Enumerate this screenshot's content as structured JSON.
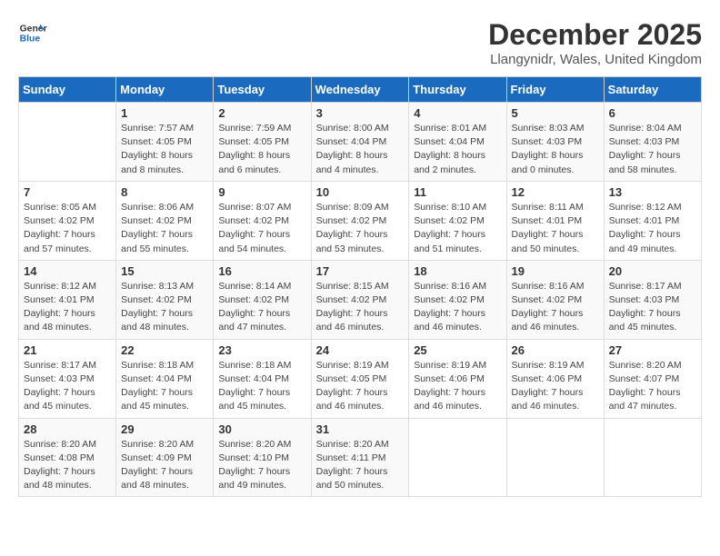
{
  "header": {
    "logo_line1": "General",
    "logo_line2": "Blue",
    "month_year": "December 2025",
    "location": "Llangynidr, Wales, United Kingdom"
  },
  "weekdays": [
    "Sunday",
    "Monday",
    "Tuesday",
    "Wednesday",
    "Thursday",
    "Friday",
    "Saturday"
  ],
  "weeks": [
    [
      {
        "day": "",
        "info": ""
      },
      {
        "day": "1",
        "info": "Sunrise: 7:57 AM\nSunset: 4:05 PM\nDaylight: 8 hours\nand 8 minutes."
      },
      {
        "day": "2",
        "info": "Sunrise: 7:59 AM\nSunset: 4:05 PM\nDaylight: 8 hours\nand 6 minutes."
      },
      {
        "day": "3",
        "info": "Sunrise: 8:00 AM\nSunset: 4:04 PM\nDaylight: 8 hours\nand 4 minutes."
      },
      {
        "day": "4",
        "info": "Sunrise: 8:01 AM\nSunset: 4:04 PM\nDaylight: 8 hours\nand 2 minutes."
      },
      {
        "day": "5",
        "info": "Sunrise: 8:03 AM\nSunset: 4:03 PM\nDaylight: 8 hours\nand 0 minutes."
      },
      {
        "day": "6",
        "info": "Sunrise: 8:04 AM\nSunset: 4:03 PM\nDaylight: 7 hours\nand 58 minutes."
      }
    ],
    [
      {
        "day": "7",
        "info": "Sunrise: 8:05 AM\nSunset: 4:02 PM\nDaylight: 7 hours\nand 57 minutes."
      },
      {
        "day": "8",
        "info": "Sunrise: 8:06 AM\nSunset: 4:02 PM\nDaylight: 7 hours\nand 55 minutes."
      },
      {
        "day": "9",
        "info": "Sunrise: 8:07 AM\nSunset: 4:02 PM\nDaylight: 7 hours\nand 54 minutes."
      },
      {
        "day": "10",
        "info": "Sunrise: 8:09 AM\nSunset: 4:02 PM\nDaylight: 7 hours\nand 53 minutes."
      },
      {
        "day": "11",
        "info": "Sunrise: 8:10 AM\nSunset: 4:02 PM\nDaylight: 7 hours\nand 51 minutes."
      },
      {
        "day": "12",
        "info": "Sunrise: 8:11 AM\nSunset: 4:01 PM\nDaylight: 7 hours\nand 50 minutes."
      },
      {
        "day": "13",
        "info": "Sunrise: 8:12 AM\nSunset: 4:01 PM\nDaylight: 7 hours\nand 49 minutes."
      }
    ],
    [
      {
        "day": "14",
        "info": "Sunrise: 8:12 AM\nSunset: 4:01 PM\nDaylight: 7 hours\nand 48 minutes."
      },
      {
        "day": "15",
        "info": "Sunrise: 8:13 AM\nSunset: 4:02 PM\nDaylight: 7 hours\nand 48 minutes."
      },
      {
        "day": "16",
        "info": "Sunrise: 8:14 AM\nSunset: 4:02 PM\nDaylight: 7 hours\nand 47 minutes."
      },
      {
        "day": "17",
        "info": "Sunrise: 8:15 AM\nSunset: 4:02 PM\nDaylight: 7 hours\nand 46 minutes."
      },
      {
        "day": "18",
        "info": "Sunrise: 8:16 AM\nSunset: 4:02 PM\nDaylight: 7 hours\nand 46 minutes."
      },
      {
        "day": "19",
        "info": "Sunrise: 8:16 AM\nSunset: 4:02 PM\nDaylight: 7 hours\nand 46 minutes."
      },
      {
        "day": "20",
        "info": "Sunrise: 8:17 AM\nSunset: 4:03 PM\nDaylight: 7 hours\nand 45 minutes."
      }
    ],
    [
      {
        "day": "21",
        "info": "Sunrise: 8:17 AM\nSunset: 4:03 PM\nDaylight: 7 hours\nand 45 minutes."
      },
      {
        "day": "22",
        "info": "Sunrise: 8:18 AM\nSunset: 4:04 PM\nDaylight: 7 hours\nand 45 minutes."
      },
      {
        "day": "23",
        "info": "Sunrise: 8:18 AM\nSunset: 4:04 PM\nDaylight: 7 hours\nand 45 minutes."
      },
      {
        "day": "24",
        "info": "Sunrise: 8:19 AM\nSunset: 4:05 PM\nDaylight: 7 hours\nand 46 minutes."
      },
      {
        "day": "25",
        "info": "Sunrise: 8:19 AM\nSunset: 4:06 PM\nDaylight: 7 hours\nand 46 minutes."
      },
      {
        "day": "26",
        "info": "Sunrise: 8:19 AM\nSunset: 4:06 PM\nDaylight: 7 hours\nand 46 minutes."
      },
      {
        "day": "27",
        "info": "Sunrise: 8:20 AM\nSunset: 4:07 PM\nDaylight: 7 hours\nand 47 minutes."
      }
    ],
    [
      {
        "day": "28",
        "info": "Sunrise: 8:20 AM\nSunset: 4:08 PM\nDaylight: 7 hours\nand 48 minutes."
      },
      {
        "day": "29",
        "info": "Sunrise: 8:20 AM\nSunset: 4:09 PM\nDaylight: 7 hours\nand 48 minutes."
      },
      {
        "day": "30",
        "info": "Sunrise: 8:20 AM\nSunset: 4:10 PM\nDaylight: 7 hours\nand 49 minutes."
      },
      {
        "day": "31",
        "info": "Sunrise: 8:20 AM\nSunset: 4:11 PM\nDaylight: 7 hours\nand 50 minutes."
      },
      {
        "day": "",
        "info": ""
      },
      {
        "day": "",
        "info": ""
      },
      {
        "day": "",
        "info": ""
      }
    ]
  ]
}
